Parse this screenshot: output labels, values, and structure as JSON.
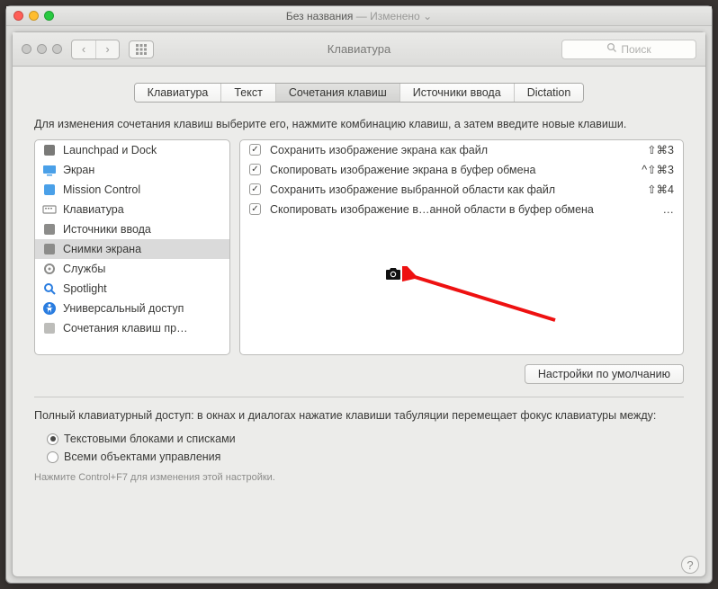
{
  "outer": {
    "title": "Без названия",
    "modified_label": "— Изменено"
  },
  "toolbar": {
    "title": "Клавиатура",
    "search_placeholder": "Поиск"
  },
  "tabs": [
    {
      "label": "Клавиатура",
      "selected": false
    },
    {
      "label": "Текст",
      "selected": false
    },
    {
      "label": "Сочетания клавиш",
      "selected": true
    },
    {
      "label": "Источники ввода",
      "selected": false
    },
    {
      "label": "Dictation",
      "selected": false
    }
  ],
  "instruction": "Для изменения сочетания клавиш выберите его, нажмите комбинацию клавиш, а затем введите новые клавиши.",
  "categories": [
    {
      "icon": "launchpad",
      "label": "Launchpad и Dock",
      "selected": false
    },
    {
      "icon": "display",
      "label": "Экран",
      "selected": false
    },
    {
      "icon": "mission",
      "label": "Mission Control",
      "selected": false
    },
    {
      "icon": "keyboard",
      "label": "Клавиатура",
      "selected": false
    },
    {
      "icon": "input",
      "label": "Источники ввода",
      "selected": false
    },
    {
      "icon": "screenshot",
      "label": "Снимки экрана",
      "selected": true
    },
    {
      "icon": "gear",
      "label": "Службы",
      "selected": false
    },
    {
      "icon": "spotlight",
      "label": "Spotlight",
      "selected": false
    },
    {
      "icon": "access",
      "label": "Универсальный доступ",
      "selected": false
    },
    {
      "icon": "app",
      "label": "Сочетания клавиш пр…",
      "selected": false
    }
  ],
  "shortcuts": [
    {
      "checked": true,
      "label": "Сохранить изображение экрана как файл",
      "key": "⇧⌘3"
    },
    {
      "checked": true,
      "label": "Скопировать изображение экрана в буфер обмена",
      "key": "^⇧⌘3"
    },
    {
      "checked": true,
      "label": "Сохранить изображение выбранной области как файл",
      "key": "⇧⌘4"
    },
    {
      "checked": true,
      "label": "Скопировать изображение в…анной области в буфер обмена",
      "key": "…"
    }
  ],
  "restore_defaults": "Настройки по умолчанию",
  "full_access_text": "Полный клавиатурный доступ: в окнах и диалогах нажатие клавиши табуляции перемещает фокус клавиатуры между:",
  "radio": {
    "opt1": "Текстовыми блоками и списками",
    "opt2": "Всеми объектами управления",
    "selected": 0
  },
  "footnote": "Нажмите Control+F7 для изменения этой настройки."
}
